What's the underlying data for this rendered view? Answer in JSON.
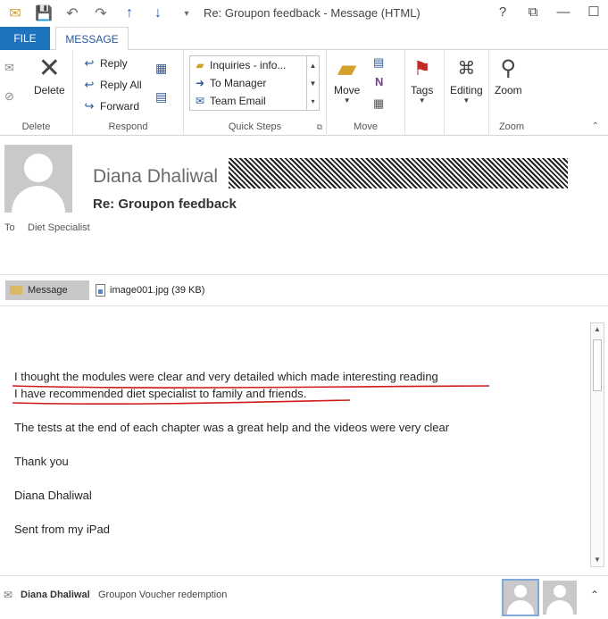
{
  "window": {
    "title": "Re: Groupon feedback - Message (HTML)",
    "controls": {
      "help": "?",
      "restore": "⧉",
      "minimize": "—",
      "maximize": "☐"
    }
  },
  "qat": {
    "icons": [
      "mail-icon",
      "save-icon",
      "undo-icon",
      "redo-icon",
      "up-icon",
      "down-icon"
    ]
  },
  "tabs": {
    "file": "FILE",
    "message": "MESSAGE"
  },
  "ribbon": {
    "delete_group": {
      "label": "Delete",
      "delete_button": "Delete"
    },
    "respond_group": {
      "label": "Respond",
      "reply": "Reply",
      "reply_all": "Reply All",
      "forward": "Forward"
    },
    "quick_steps_group": {
      "label": "Quick Steps",
      "items": [
        "Inquiries - info...",
        "To Manager",
        "Team Email"
      ]
    },
    "move_group": {
      "label": "Move",
      "move_button": "Move"
    },
    "tags_group": {
      "tags_button": "Tags"
    },
    "editing_group": {
      "editing_button": "Editing"
    },
    "zoom_group": {
      "label": "Zoom",
      "zoom_button": "Zoom"
    }
  },
  "header": {
    "sender": "Diana Dhaliwal",
    "subject": "Re: Groupon feedback",
    "to_label": "To",
    "to_value": "Diet Specialist"
  },
  "attachments": {
    "message_tab": "Message",
    "file": "image001.jpg (39 KB)"
  },
  "body": {
    "lines": [
      "I thought the modules were clear and very detailed which made interesting reading",
      "I have recommended diet specialist to family and friends.",
      "The tests at the end of each chapter was a great help and the videos were very clear",
      "Thank you",
      "Diana Dhaliwal",
      "Sent from my iPad"
    ]
  },
  "people_pane": {
    "name": "Diana Dhaliwal",
    "subject": "Groupon Voucher redemption"
  },
  "colors": {
    "accent": "#1e73be",
    "underline": "#d11a1a"
  }
}
